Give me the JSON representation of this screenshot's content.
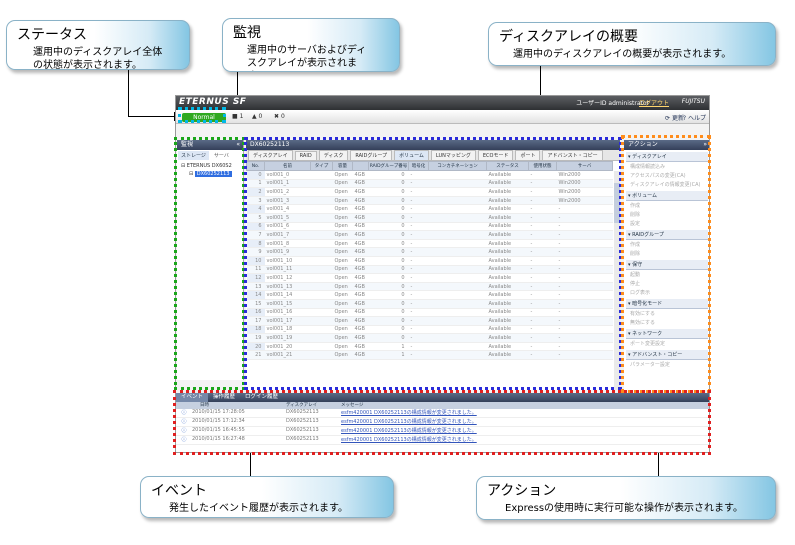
{
  "callouts": {
    "status": {
      "title": "ステータス",
      "desc": "運用中のディスクアレイ全体の状態が表示されます。"
    },
    "monitor": {
      "title": "監視",
      "desc": "運用中のサーバおよびディスクアレイが表示されます。"
    },
    "overview": {
      "title": "ディスクアレイの概要",
      "desc": "運用中のディスクアレイの概要が表示されます。"
    },
    "event": {
      "title": "イベント",
      "desc": "発生したイベント履歴が表示されます。"
    },
    "action": {
      "title": "アクション",
      "desc": "Expressの使用時に実行可能な操作が表示されます。"
    }
  },
  "app": {
    "logo": "ETERNUS SF",
    "user": "ユーザーID administrator",
    "logout": "ログアウト",
    "brand": "FUJITSU",
    "status": "Normal",
    "counts": [
      "1",
      "0",
      "0"
    ],
    "refresh": "更新",
    "help": "ヘルプ"
  },
  "monitor_panel": {
    "title": "監視",
    "tabs": [
      "ストレージ",
      "サーバ"
    ],
    "tree": [
      "ETERNUS DX60S2",
      "DX60252113"
    ]
  },
  "main_panel": {
    "title": "DX60252113",
    "tabs": [
      "ディスクアレイ",
      "RAID",
      "ディスク",
      "RAIDグループ",
      "ボリューム",
      "LUNマッピング",
      "ECOモード",
      "ポート",
      "アドバンスト・コピー"
    ],
    "columns": [
      "No.",
      "名前",
      "タイプ",
      "容量",
      "RAIDグループ番号",
      "暗号化",
      "コンカチネーション",
      "ステータス",
      "使用状態",
      "サーバ"
    ],
    "rows": [
      [
        "0",
        "vol001_0",
        "Open",
        "4GB",
        "0",
        "-",
        "Available",
        "-",
        "Win2000"
      ],
      [
        "1",
        "vol001_1",
        "Open",
        "4GB",
        "0",
        "-",
        "Available",
        "-",
        "Win2000"
      ],
      [
        "2",
        "vol001_2",
        "Open",
        "4GB",
        "0",
        "-",
        "Available",
        "-",
        "Win2000"
      ],
      [
        "3",
        "vol001_3",
        "Open",
        "4GB",
        "0",
        "-",
        "Available",
        "-",
        "Win2000"
      ],
      [
        "4",
        "vol001_4",
        "Open",
        "4GB",
        "0",
        "-",
        "Available",
        "-",
        "-"
      ],
      [
        "5",
        "vol001_5",
        "Open",
        "4GB",
        "0",
        "-",
        "Available",
        "-",
        "-"
      ],
      [
        "6",
        "vol001_6",
        "Open",
        "4GB",
        "0",
        "-",
        "Available",
        "-",
        "-"
      ],
      [
        "7",
        "vol001_7",
        "Open",
        "4GB",
        "0",
        "-",
        "Available",
        "-",
        "-"
      ],
      [
        "8",
        "vol001_8",
        "Open",
        "4GB",
        "0",
        "-",
        "Available",
        "-",
        "-"
      ],
      [
        "9",
        "vol001_9",
        "Open",
        "4GB",
        "0",
        "-",
        "Available",
        "-",
        "-"
      ],
      [
        "10",
        "vol001_10",
        "Open",
        "4GB",
        "0",
        "-",
        "Available",
        "-",
        "-"
      ],
      [
        "11",
        "vol001_11",
        "Open",
        "4GB",
        "0",
        "-",
        "Available",
        "-",
        "-"
      ],
      [
        "12",
        "vol001_12",
        "Open",
        "4GB",
        "0",
        "-",
        "Available",
        "-",
        "-"
      ],
      [
        "13",
        "vol001_13",
        "Open",
        "4GB",
        "0",
        "-",
        "Available",
        "-",
        "-"
      ],
      [
        "14",
        "vol001_14",
        "Open",
        "4GB",
        "0",
        "-",
        "Available",
        "-",
        "-"
      ],
      [
        "15",
        "vol001_15",
        "Open",
        "4GB",
        "0",
        "-",
        "Available",
        "-",
        "-"
      ],
      [
        "16",
        "vol001_16",
        "Open",
        "4GB",
        "0",
        "-",
        "Available",
        "-",
        "-"
      ],
      [
        "17",
        "vol001_17",
        "Open",
        "4GB",
        "0",
        "-",
        "Available",
        "-",
        "-"
      ],
      [
        "18",
        "vol001_18",
        "Open",
        "4GB",
        "0",
        "-",
        "Available",
        "-",
        "-"
      ],
      [
        "19",
        "vol001_19",
        "Open",
        "4GB",
        "0",
        "-",
        "Available",
        "-",
        "-"
      ],
      [
        "20",
        "vol001_20",
        "Open",
        "4GB",
        "1",
        "-",
        "Available",
        "-",
        "-"
      ],
      [
        "21",
        "vol001_21",
        "Open",
        "4GB",
        "1",
        "-",
        "Available",
        "-",
        "-"
      ]
    ]
  },
  "action_panel": {
    "title": "アクション",
    "groups": [
      {
        "label": "ディスクアレイ",
        "items": [
          "構成情報読込み",
          "アクセスパスの変更(CA)",
          "ディスクアレイの情報変更(CA)"
        ]
      },
      {
        "label": "ボリューム",
        "items": [
          "作成",
          "削除",
          "設定"
        ]
      },
      {
        "label": "RAIDグループ",
        "items": [
          "作成",
          "削除"
        ]
      },
      {
        "label": "保守",
        "items": [
          "起動",
          "停止",
          "ログ表示"
        ]
      },
      {
        "label": "暗号化モード",
        "items": [
          "有効にする",
          "無効にする"
        ]
      },
      {
        "label": "ネットワーク",
        "items": [
          "ポート変更設定"
        ]
      },
      {
        "label": "アドバンスト・コピー",
        "items": [
          "パラメーター設定"
        ]
      }
    ]
  },
  "event_panel": {
    "tabs": [
      "イベント",
      "操作履歴",
      "ログイン履歴"
    ],
    "columns": [
      "日時",
      "ディスクアレイ",
      "メッセージ"
    ],
    "rows": [
      {
        "date": "2010/01/15 17:28:05",
        "array": "DX60252113",
        "msg": "esfm420001 DX60252113の構成情報が変更されました。"
      },
      {
        "date": "2010/01/15 17:12:34",
        "array": "DX60252113",
        "msg": "esfm420001 DX60252113の構成情報が変更されました。"
      },
      {
        "date": "2010/01/15 16:45:55",
        "array": "DX60252113",
        "msg": "esfm420001 DX60252113の構成情報が変更されました。"
      },
      {
        "date": "2010/01/15 16:27:48",
        "array": "DX60252113",
        "msg": "esfm420001 DX60252113の構成情報が変更されました。"
      }
    ]
  },
  "colors": {
    "status": "#00b8e6",
    "monitor": "#1aa61a",
    "overview": "#2b2bd9",
    "action": "#ff8c1a",
    "event": "#e02020"
  }
}
